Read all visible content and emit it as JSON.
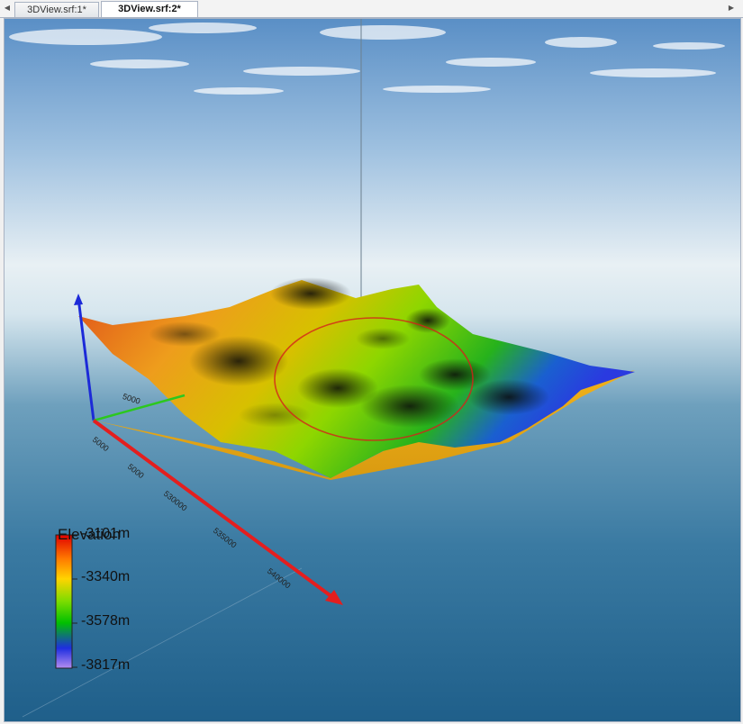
{
  "tabs": [
    {
      "label": "3DView.srf:1*",
      "active": false
    },
    {
      "label": "3DView.srf:2*",
      "active": true
    }
  ],
  "legend": {
    "title": "Elevation",
    "labels": [
      "-3101m",
      "-3340m",
      "-3578m",
      "-3817m"
    ]
  },
  "axis_ticks": {
    "x": [
      "5000",
      "5000",
      "530000",
      "535000",
      "540000"
    ],
    "y": [
      "5000"
    ]
  },
  "icons": {
    "scroll_left": "triangle-left-icon",
    "scroll_right": "triangle-right-icon"
  },
  "colors": {
    "x_axis": "#e41e1e",
    "y_axis": "#2cc81e",
    "z_axis": "#1c2ad8",
    "sky_top": "#5a8fc6",
    "horizon": "#e6f0f6",
    "water": "#2a6b93"
  }
}
